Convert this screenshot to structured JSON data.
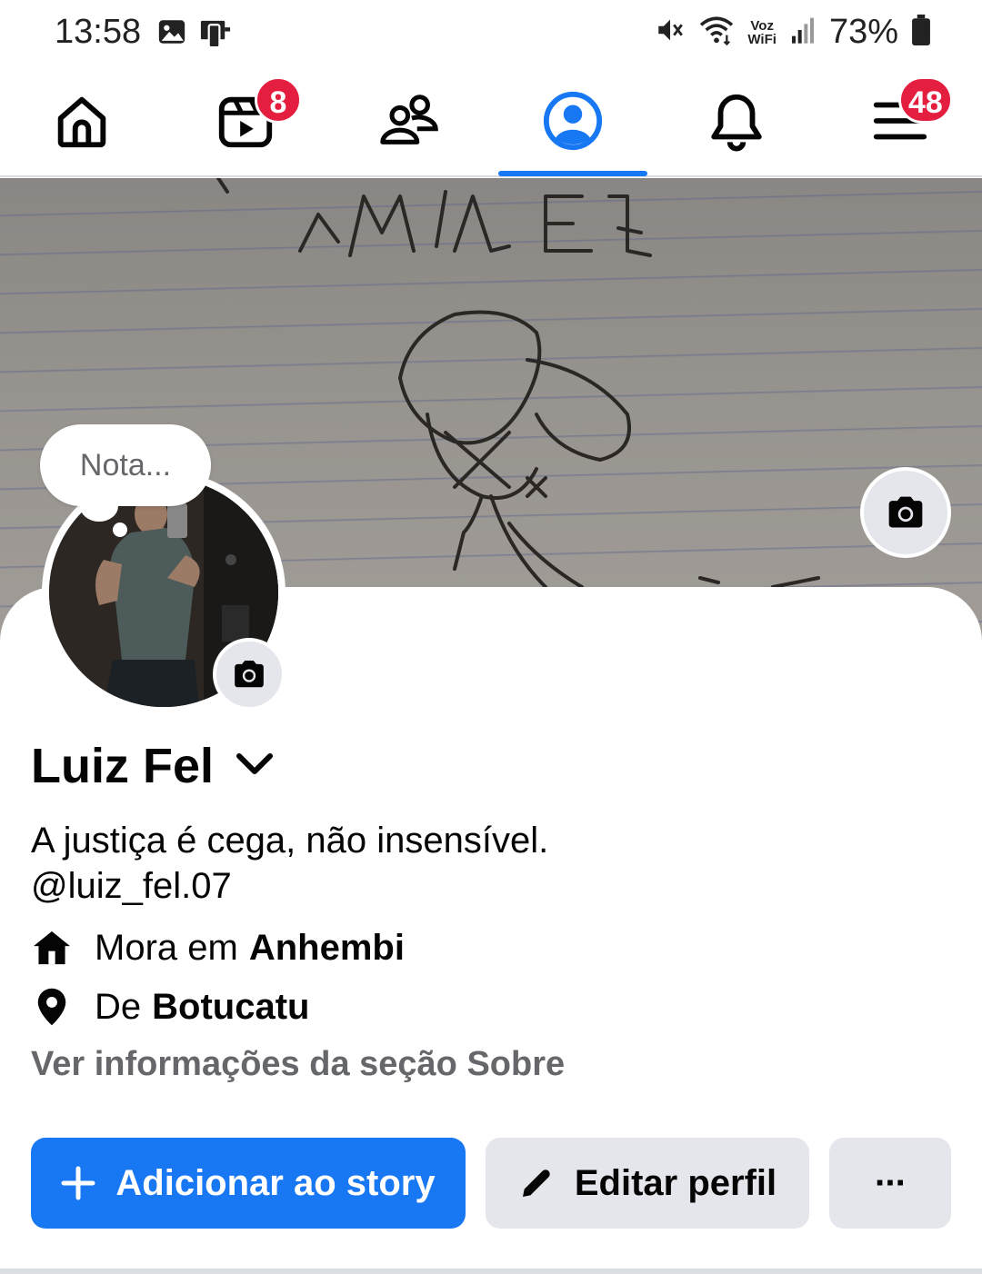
{
  "status_bar": {
    "time": "13:58",
    "left_icons": [
      "image-icon",
      "phone-link-icon"
    ],
    "right_icons": [
      "mute-icon",
      "wifi-icon",
      "signal-icon",
      "battery-icon"
    ],
    "voz_line1": "Voz",
    "voz_line2": "WiFi",
    "battery": "73%"
  },
  "nav": {
    "items": [
      {
        "name": "home",
        "icon": "home-icon"
      },
      {
        "name": "video",
        "icon": "video-icon",
        "badge": "8"
      },
      {
        "name": "friends",
        "icon": "friends-icon"
      },
      {
        "name": "profile",
        "icon": "profile-icon",
        "active": true
      },
      {
        "name": "notifications",
        "icon": "bell-icon"
      },
      {
        "name": "menu",
        "icon": "menu-icon",
        "badge": "48"
      }
    ],
    "active_color": "#1877f2",
    "badge_color": "#e41e3f"
  },
  "cover": {
    "camera_icon": "camera-icon"
  },
  "note": {
    "placeholder": "Nota..."
  },
  "profile": {
    "name": "Luiz Fel",
    "bio_line1": "A justiça é cega, não insensível.",
    "bio_line2": "@luiz_fel.07",
    "lives_in_prefix": "Mora em",
    "lives_in_place": "Anhembi",
    "from_prefix": "De",
    "from_place": "Botucatu",
    "see_about": "Ver informações da seção Sobre"
  },
  "actions": {
    "add_story": "Adicionar ao story",
    "edit_profile": "Editar perfil",
    "more": "···"
  }
}
